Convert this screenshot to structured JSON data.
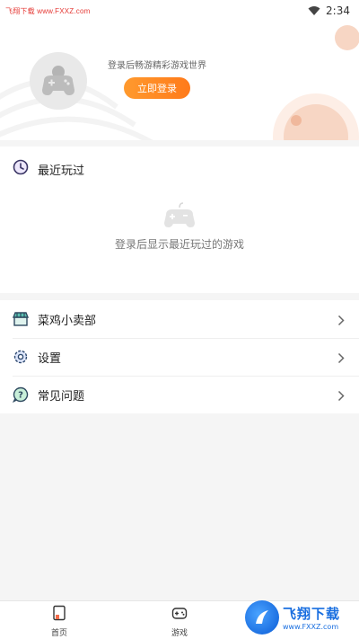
{
  "status_bar": {
    "watermark": "飞翔下载 www.FXXZ.com",
    "time": "2:34"
  },
  "header": {
    "login_prompt": "登录后畅游精彩游戏世界",
    "login_button": "立即登录"
  },
  "recent": {
    "title": "最近玩过",
    "empty_text": "登录后显示最近玩过的游戏"
  },
  "menu": {
    "items": [
      {
        "label": "菜鸡小卖部",
        "icon": "store-icon"
      },
      {
        "label": "设置",
        "icon": "gear-icon"
      },
      {
        "label": "常见问题",
        "icon": "help-icon"
      }
    ]
  },
  "bottom_nav": {
    "items": [
      {
        "label": "首页",
        "icon": "home-icon"
      },
      {
        "label": "游戏",
        "icon": "gamepad-icon"
      }
    ]
  },
  "watermark_bottom": {
    "title": "飞翔下载",
    "url": "www.FXXZ.com"
  },
  "colors": {
    "accent": "#ff8a24",
    "background": "#f5f5f5"
  }
}
